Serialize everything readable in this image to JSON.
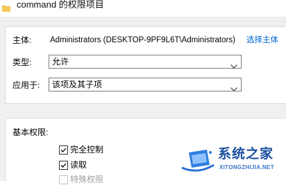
{
  "window": {
    "title": "command 的权限项目",
    "icon": "folder-icon"
  },
  "principal": {
    "label": "主体:",
    "value": "Administrators (DESKTOP-9PF9L6T\\Administrators)",
    "select_link": "选择主体"
  },
  "type": {
    "label": "类型:",
    "selected": "允许"
  },
  "applies_to": {
    "label": "应用于:",
    "selected": "该项及其子项"
  },
  "basic_permissions": {
    "label": "基本权限:",
    "items": [
      {
        "label": "完全控制",
        "checked": true,
        "enabled": true
      },
      {
        "label": "读取",
        "checked": true,
        "enabled": true
      },
      {
        "label": "特殊权限",
        "checked": false,
        "enabled": false
      }
    ]
  },
  "watermark": {
    "name": "系统之家",
    "url": "XITONGZHIJIA.NET"
  },
  "colors": {
    "link": "#0066cc",
    "panel": "#f0f0f0",
    "watermark": "#1a4fa0"
  }
}
